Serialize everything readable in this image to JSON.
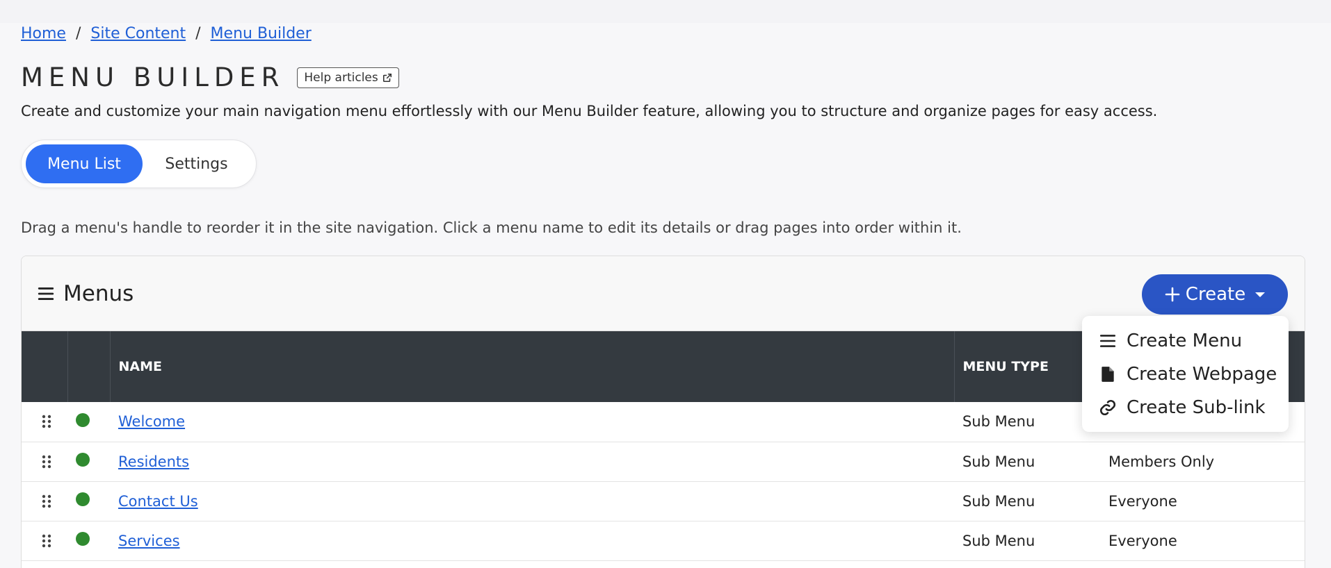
{
  "breadcrumb": {
    "items": [
      "Home",
      "Site Content",
      "Menu Builder"
    ],
    "separator": "/"
  },
  "page": {
    "title": "MENU BUILDER",
    "help_label": "Help articles",
    "description": "Create and customize your main navigation menu effortlessly with our Menu Builder feature, allowing you to structure and organize pages for easy access."
  },
  "toggle": {
    "active": "Menu List",
    "inactive": "Settings"
  },
  "instructions": "Drag a menu's handle to reorder it in the site navigation. Click a menu name to edit its details or drag pages into order within it.",
  "card": {
    "title": "Menus",
    "create_label": "Create"
  },
  "table": {
    "headers": [
      "NAME",
      "MENU TYPE",
      ""
    ],
    "rows": [
      {
        "name": "Welcome",
        "type": "Sub Menu",
        "visibility": ""
      },
      {
        "name": "Residents",
        "type": "Sub Menu",
        "visibility": "Members Only"
      },
      {
        "name": "Contact Us",
        "type": "Sub Menu",
        "visibility": "Everyone"
      },
      {
        "name": "Services",
        "type": "Sub Menu",
        "visibility": "Everyone"
      }
    ]
  },
  "dropdown": {
    "items": [
      {
        "label": "Create Menu",
        "icon": "list-icon"
      },
      {
        "label": "Create Webpage",
        "icon": "file-icon"
      },
      {
        "label": "Create Sub-link",
        "icon": "link-icon"
      }
    ]
  },
  "colors": {
    "primary": "#2f6ef2",
    "create_button": "#2a55c5",
    "table_header": "#343a40",
    "link": "#1f5fd6",
    "status_active": "#2f8a2f"
  }
}
